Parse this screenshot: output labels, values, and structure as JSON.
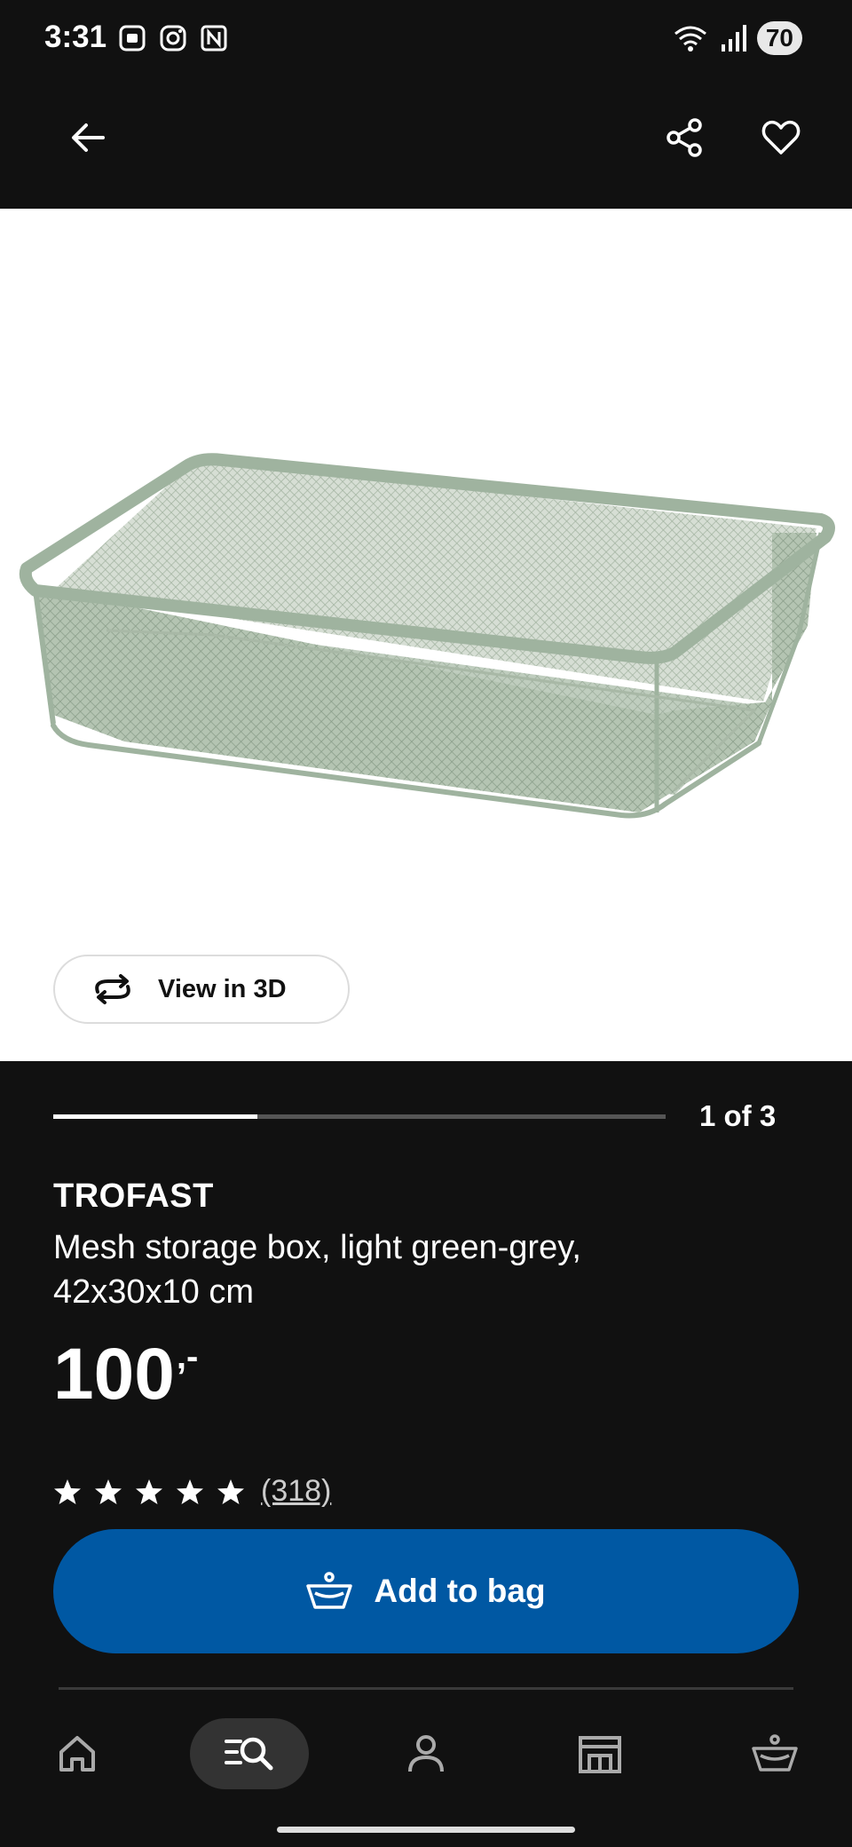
{
  "status_bar": {
    "time": "3:31",
    "battery": "70"
  },
  "app_bar": {
    "back_icon": "arrow-left-icon",
    "share_icon": "share-icon",
    "favourite_icon": "heart-icon"
  },
  "product_image": {
    "view_3d_label": "View in 3D",
    "view_3d_icon": "rotate-3d-icon"
  },
  "gallery": {
    "progress_text": "1 of 3",
    "current": 1,
    "total": 3
  },
  "product": {
    "brand": "TROFAST",
    "description": "Mesh storage box, light green-grey, 42x30x10 cm",
    "price": "100",
    "price_suffix": ",-",
    "rating_stars": 5,
    "review_count": "(318)"
  },
  "actions": {
    "add_to_bag_label": "Add to bag",
    "add_to_bag_icon": "basket-icon"
  },
  "bottom_nav": {
    "items": [
      {
        "name": "home",
        "icon": "home-icon",
        "active": false
      },
      {
        "name": "search",
        "icon": "search-icon",
        "active": true
      },
      {
        "name": "profile",
        "icon": "person-icon",
        "active": false
      },
      {
        "name": "store",
        "icon": "store-icon",
        "active": false
      },
      {
        "name": "bag",
        "icon": "basket-icon",
        "active": false
      }
    ]
  },
  "colors": {
    "background": "#111111",
    "primary_button": "#0058a3",
    "product_green": "#9fb39f"
  }
}
